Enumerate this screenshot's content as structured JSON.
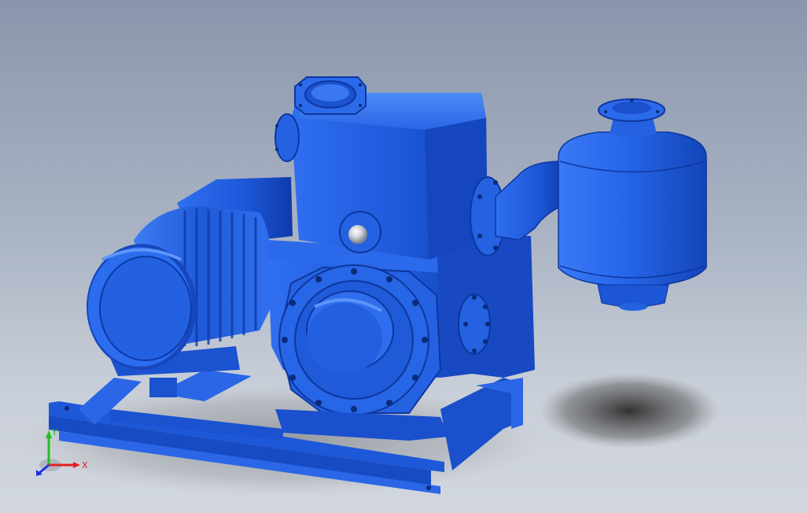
{
  "viewport": {
    "background_top": "#8a96ad",
    "background_bottom": "#d2d7de",
    "model_color": "#1f5fe0",
    "model_highlight": "#4b86f5",
    "model_shadow": "#0d2f8a"
  },
  "triad": {
    "x_label": "X",
    "y_label": "Y",
    "x_color": "#e02020",
    "y_color": "#20c020",
    "z_color": "#2030e0"
  }
}
